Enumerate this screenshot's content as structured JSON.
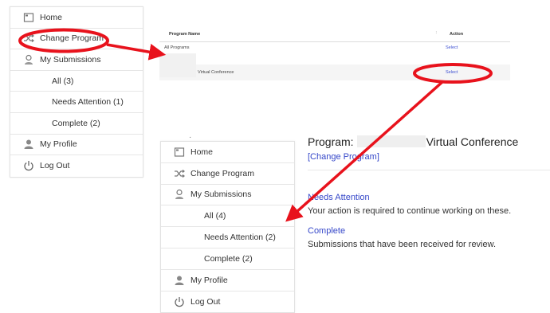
{
  "sidebar_top": {
    "items": [
      {
        "label": "Home",
        "icon": "home-icon"
      },
      {
        "label": "Change Program",
        "icon": "shuffle-icon"
      },
      {
        "label": "My Submissions",
        "icon": "submissions-icon"
      },
      {
        "label": "All (3)"
      },
      {
        "label": "Needs Attention (1)"
      },
      {
        "label": "Complete (2)"
      },
      {
        "label": "My Profile",
        "icon": "profile-icon"
      },
      {
        "label": "Log Out",
        "icon": "power-icon"
      }
    ]
  },
  "program_table": {
    "col_program": "Program Name",
    "col_action": "Action",
    "rows": [
      {
        "name": "All Programs",
        "action": "Select"
      },
      {
        "name": "Virtual Conference",
        "action": "Select"
      }
    ]
  },
  "sidebar_bottom": {
    "items": [
      {
        "label": "Home",
        "icon": "home-icon"
      },
      {
        "label": "Change Program",
        "icon": "shuffle-icon"
      },
      {
        "label": "My Submissions",
        "icon": "submissions-icon"
      },
      {
        "label": "All (4)"
      },
      {
        "label": "Needs Attention (2)"
      },
      {
        "label": "Complete (2)"
      },
      {
        "label": "My Profile",
        "icon": "profile-icon"
      },
      {
        "label": "Log Out",
        "icon": "power-icon"
      }
    ]
  },
  "main": {
    "program_prefix": "Program:",
    "program_name": "Virtual Conference",
    "change_program": "[Change Program]",
    "sections": [
      {
        "title": "Needs Attention",
        "desc": "Your action is required to continue working on these."
      },
      {
        "title": "Complete",
        "desc": "Submissions that have been received for review."
      }
    ]
  },
  "colors": {
    "annotation": "#e8121c",
    "link": "#3547c9"
  }
}
